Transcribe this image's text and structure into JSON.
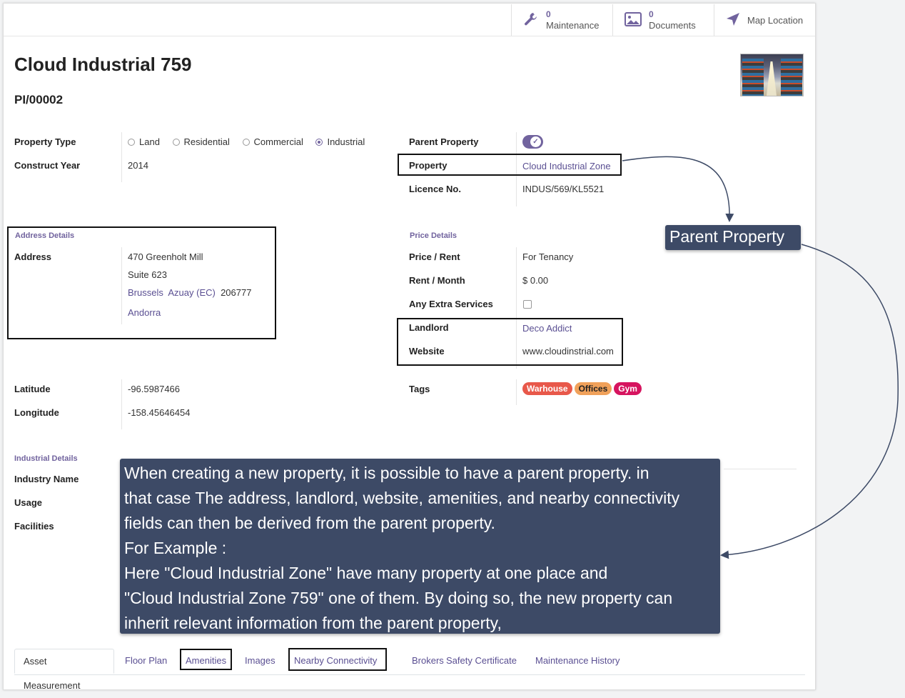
{
  "buttons": {
    "maintenance": {
      "count": "0",
      "label": "Maintenance"
    },
    "documents": {
      "count": "0",
      "label": "Documents"
    },
    "map": {
      "label": "Map Location"
    }
  },
  "record": {
    "title": "Cloud Industrial 759",
    "reference": "PI/00002"
  },
  "fields": {
    "property_type": {
      "label": "Property Type",
      "options": [
        "Land",
        "Residential",
        "Commercial",
        "Industrial"
      ],
      "selected": "Industrial"
    },
    "construct_year": {
      "label": "Construct Year",
      "value": "2014"
    },
    "parent_property": {
      "label": "Parent Property",
      "value": true
    },
    "property": {
      "label": "Property",
      "value": "Cloud Industrial Zone"
    },
    "licence": {
      "label": "Licence No.",
      "value": "INDUS/569/KL5521"
    }
  },
  "address": {
    "section": "Address Details",
    "label": "Address",
    "street": "470 Greenholt Mill",
    "street2": "Suite 623",
    "city": "Brussels",
    "state": "Azuay (EC)",
    "zip": "206777",
    "country": "Andorra"
  },
  "price": {
    "section": "Price Details",
    "price_rent_label": "Price / Rent",
    "price_rent_value": "For Tenancy",
    "rent_month_label": "Rent / Month",
    "rent_month_value": "$ 0.00",
    "extra_label": "Any Extra Services",
    "landlord_label": "Landlord",
    "landlord_value": "Deco Addict",
    "website_label": "Website",
    "website_value": "www.cloudinstrial.com"
  },
  "location": {
    "latitude_label": "Latitude",
    "latitude_value": "-96.5987466",
    "longitude_label": "Longitude",
    "longitude_value": "-158.45646454"
  },
  "tags": {
    "label": "Tags",
    "items": [
      {
        "name": "Warhouse",
        "color": "#e8584a"
      },
      {
        "name": "Offices",
        "color": "#f0a15a"
      },
      {
        "name": "Gym",
        "color": "#d6145f"
      }
    ]
  },
  "industrial": {
    "section": "Industrial Details",
    "industry_name": "Industry Name",
    "usage": "Usage",
    "facilities": "Facilities"
  },
  "callouts": {
    "parent": "Parent Property",
    "explanation": "When creating a new property, it is possible to have a parent property. in\nthat case The address, landlord, website, amenities, and nearby connectivity\nfields can then be derived from the parent property.\nFor Example :\nHere \"Cloud Industrial Zone\" have many property at one place and\n\"Cloud Industrial Zone 759\" one of them. By doing so, the new property can\ninherit relevant information from  the parent property,"
  },
  "tabs": [
    "Asset Measurement",
    "Floor Plan",
    "Amenities",
    "Images",
    "Nearby Connectivity",
    "Brokers",
    "Safety Certificate",
    "Maintenance History"
  ],
  "colors": {
    "accent": "#71639e",
    "link": "#5a4f92",
    "callout_bg": "#3d4a66"
  }
}
